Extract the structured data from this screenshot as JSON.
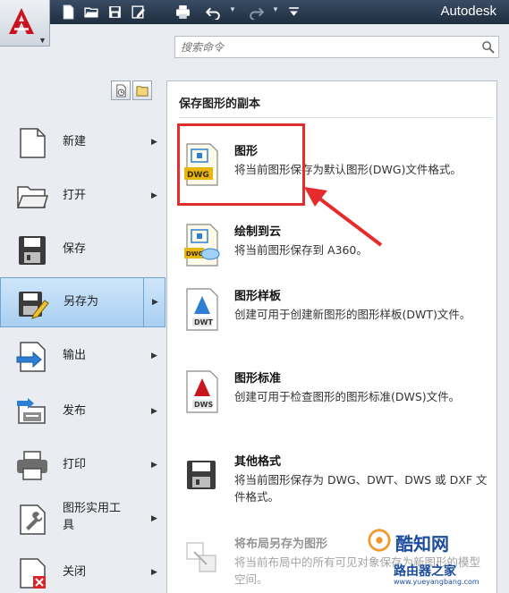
{
  "titlebar": {
    "brand": "Autodesk"
  },
  "quick_access": [
    "new-icon",
    "open-icon",
    "save-icon",
    "saveas-icon",
    "print-icon",
    "undo-icon",
    "redo-icon",
    "customize-icon"
  ],
  "search": {
    "placeholder": "搜索命令"
  },
  "nav": {
    "items": [
      {
        "label": "新建",
        "icon": "new-document-icon",
        "has_submenu": true
      },
      {
        "label": "打开",
        "icon": "open-folder-icon",
        "has_submenu": true
      },
      {
        "label": "保存",
        "icon": "save-disk-icon",
        "has_submenu": false
      },
      {
        "label": "另存为",
        "icon": "save-as-disk-icon",
        "has_submenu": true,
        "active": true
      },
      {
        "label": "输出",
        "icon": "export-icon",
        "has_submenu": true
      },
      {
        "label": "发布",
        "icon": "publish-icon",
        "has_submenu": true
      },
      {
        "label": "打印",
        "icon": "printer-icon",
        "has_submenu": true
      },
      {
        "label": "图形实用工具",
        "label_line1": "图形实用工",
        "label_line2": "具",
        "icon": "drawing-utilities-icon",
        "has_submenu": true
      },
      {
        "label": "关闭",
        "icon": "close-document-icon",
        "has_submenu": true
      }
    ]
  },
  "panel": {
    "title": "保存图形的副本",
    "options": [
      {
        "title": "图形",
        "desc": "将当前图形保存为默认图形(DWG)文件格式。",
        "icon": "dwg-file-icon",
        "badge": "DWG"
      },
      {
        "title": "绘制到云",
        "desc": "将当前图形保存到 A360。",
        "icon": "dwg-cloud-icon",
        "badge": "DWG"
      },
      {
        "title": "图形样板",
        "desc": "创建可用于创建新图形的图形样板(DWT)文件。",
        "icon": "dwt-file-icon",
        "badge": "DWT"
      },
      {
        "title": "图形标准",
        "desc": "创建可用于检查图形的图形标准(DWS)文件。",
        "icon": "dws-file-icon",
        "badge": "DWS"
      },
      {
        "title": "其他格式",
        "desc": "将当前图形保存为 DWG、DWT、DWS 或 DXF 文件格式。",
        "icon": "other-formats-disk-icon",
        "badge": ""
      },
      {
        "title": "将布局另存为图形",
        "desc": "将当前布局中的所有可见对象保存为新图形的模型空间。",
        "icon": "layout-to-drawing-icon",
        "badge": ""
      }
    ]
  },
  "watermark": {
    "line1": "酷知网",
    "line2": "路由器之家",
    "url": "www.yueyangbang.com"
  },
  "colors": {
    "highlight": "#e52b2b",
    "titlebar": "#2a3a50",
    "active_nav": "#bcdaf6",
    "brand_red": "#c8141e"
  }
}
